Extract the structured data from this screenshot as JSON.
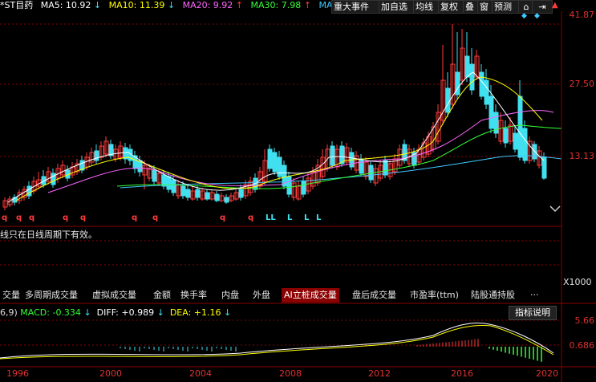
{
  "indicators": {
    "stock_name": "*ST目药",
    "ma5": "MA5: 10.92",
    "ma10": "MA10: 11.39",
    "ma20": "MA20: 9.92",
    "ma30": "MA30: 7.98",
    "ma60_partial": "MA(",
    "ma5_arrow": "↓",
    "ma10_arrow": "↓",
    "ma20_arrow": "↑",
    "ma30_arrow": "↑"
  },
  "toolbar": {
    "major_events": "重大事件",
    "add_watchlist": "加自选",
    "ma_line": "均线",
    "restore_rights": "复权",
    "overlay": "叠",
    "window": "窗",
    "forecast": "预测"
  },
  "price_axis": {
    "top": "41.87",
    "mid": "27.50",
    "low": "13.13"
  },
  "signals": {
    "buy_marks": [
      "q",
      "q",
      "q",
      "q",
      "q",
      "q",
      "q",
      "q",
      "q"
    ],
    "sell_marks": [
      "LL",
      "L",
      "L",
      "L"
    ]
  },
  "notice": "线只在日线周期下有效。",
  "volume_axis": "X1000",
  "tabs": [
    "交量",
    "多周期成交量",
    "虚拟成交量",
    "金额",
    "换手率",
    "内盘",
    "外盘",
    "AI立桩成交量",
    "盘后成交量",
    "市盈率(ttm)",
    "陆股通持股",
    "···"
  ],
  "active_tab": "AI立桩成交量",
  "macd": {
    "params": "6,9)",
    "macd": "MACD: -0.334",
    "macd_arrow": "↓",
    "diff": "DIFF: +0.989",
    "diff_arrow": "↓",
    "dea": "DEA: +1.16",
    "dea_arrow": "↓",
    "help": "指标说明",
    "axis_top": "5.66",
    "axis_low": "0.686"
  },
  "x_axis": [
    "1996",
    "2000",
    "2004",
    "2008",
    "2012",
    "2016",
    "2020"
  ],
  "colors": {
    "up": "#ff3b3b",
    "down": "#40e0f0",
    "ma5": "#ffffff",
    "ma10": "#ffff00",
    "ma20": "#ff66ff",
    "ma30": "#33ff33",
    "ma60": "#40c8ff",
    "grid": "#8b0000"
  }
}
